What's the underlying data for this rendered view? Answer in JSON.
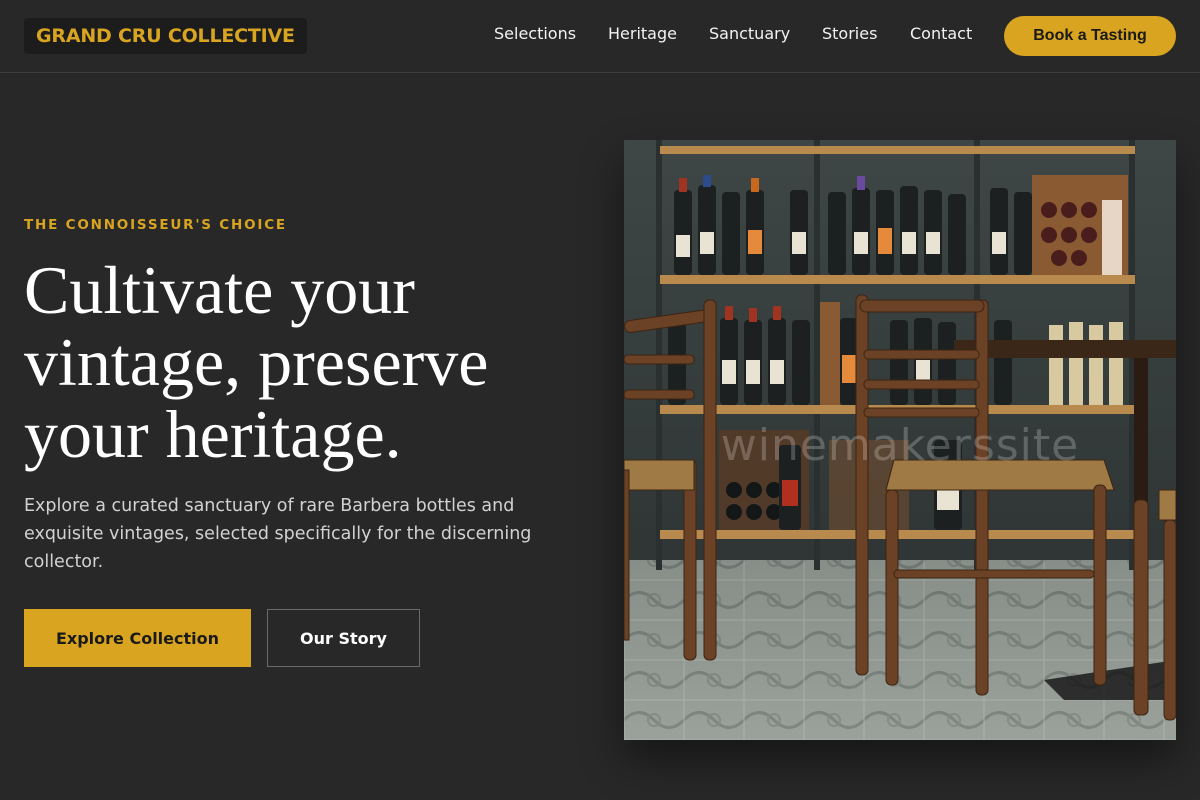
{
  "brand": {
    "name": "GRAND CRU COLLECTIVE",
    "accent": "#d9a521",
    "background": "#282828"
  },
  "nav": {
    "items": [
      {
        "label": "Selections"
      },
      {
        "label": "Heritage"
      },
      {
        "label": "Sanctuary"
      },
      {
        "label": "Stories"
      },
      {
        "label": "Contact"
      }
    ],
    "cta_label": "Book a Tasting"
  },
  "hero": {
    "eyebrow": "THE CONNOISSEUR'S CHOICE",
    "headline": "Cultivate your vintage, preserve your heritage.",
    "subtext": "Explore a curated sanctuary of rare Barbera bottles and exquisite vintages, selected specifically for the discerning collector.",
    "primary_button": "Explore Collection",
    "secondary_button": "Our Story",
    "image": {
      "subject": "wine-shop-interior-photo",
      "watermark": "winemakerssite"
    }
  }
}
